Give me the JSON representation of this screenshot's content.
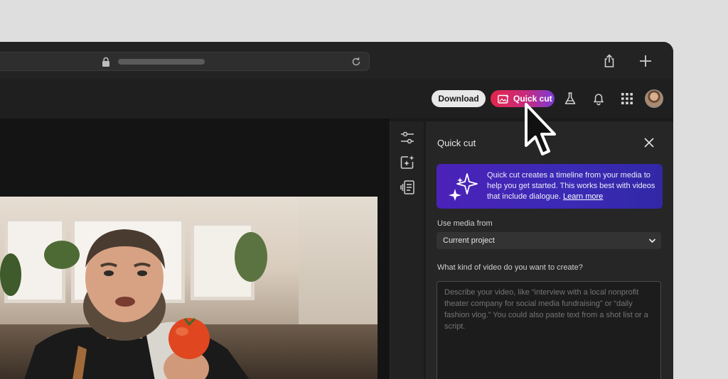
{
  "header": {
    "download_label": "Download",
    "quick_cut_label": "Quick cut"
  },
  "panel": {
    "title": "Quick cut",
    "info_text": "Quick cut creates a timeline from your media to help you get started. This works best with videos that include dialogue.",
    "learn_more": "Learn more",
    "media_label": "Use media from",
    "media_value": "Current project",
    "prompt_label": "What kind of video do you want to create?",
    "prompt_placeholder": "Describe your video, like “interview with a local nonprofit theater company for social media fundraising” or “daily fashion vlog.” You could also paste text from a shot list or a script."
  },
  "colors": {
    "quick_cut_gradient": [
      "#e3254c",
      "#c82b7c",
      "#7a3bd6"
    ],
    "info_box": "#4b22b8",
    "window_bg": "#1b1b1b"
  },
  "icons": {
    "browser": [
      "lock-icon",
      "reload-icon",
      "share-icon",
      "new-tab-icon"
    ],
    "header": [
      "labs-flask-icon",
      "notification-bell-icon",
      "apps-grid-icon"
    ],
    "rail": [
      "adjust-sliders-icon",
      "ai-enhance-icon",
      "transcript-icon"
    ]
  }
}
